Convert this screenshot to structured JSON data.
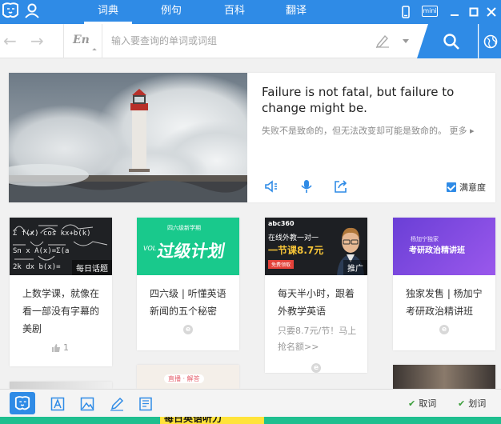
{
  "tabs": [
    "词典",
    "例句",
    "百科",
    "翻译"
  ],
  "window": {
    "mini_label": "mini"
  },
  "search": {
    "lang": "En",
    "placeholder": "输入要查询的单词或词组"
  },
  "hero": {
    "quote_en": "Failure is not fatal, but failure to change might be.",
    "quote_zh": "失败不是致命的，但无法改变却可能是致命的。",
    "more_label": "更多",
    "satisfaction_label": "满意度"
  },
  "cards": [
    {
      "title": "上数学课，就像在看一部没有字幕的美剧",
      "tag": "每日话题",
      "meta": "1"
    },
    {
      "title": "四六级 | 听懂英语新闻的五个秘密",
      "thumb_text": "过级计划",
      "thumb_top": "四六级新学期",
      "thumb_vol": "VOL"
    },
    {
      "title": "每天半小时，跟着外教学英语",
      "meta": "只要8.7元/节！马上抢名额>>",
      "tag": "推广",
      "thumb_brand": "abc360",
      "thumb_line1": "在线外教一对一",
      "thumb_line2": "一节课8.7元",
      "thumb_btn": "免费领取"
    },
    {
      "title": "独家发售 | 杨加宁考研政治精讲班",
      "thumb_text": "考研政治精讲班",
      "thumb_top": "杨加宁独家"
    }
  ],
  "partial_card": {
    "text": "直播 · 解答"
  },
  "bottom": {
    "option1": "取词",
    "option2": "划词"
  },
  "strip_text": "每日英语听力"
}
